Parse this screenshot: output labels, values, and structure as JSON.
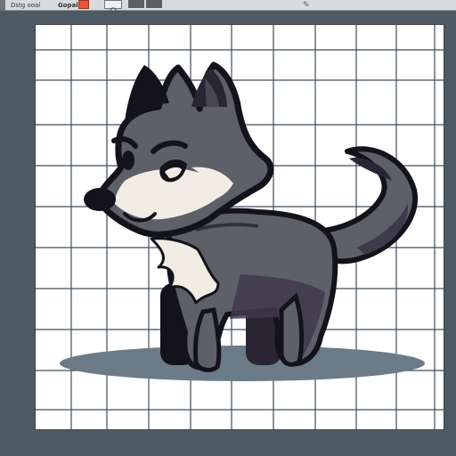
{
  "toolbar": {
    "label_left": "Dstg ooal",
    "label_mode": "Gopal",
    "dropdown_arrow": "▾",
    "icons": [
      "left-scroll-icon",
      "eye-icon",
      "copy-icon",
      "square-icon",
      "color-swatch-icon",
      "circle-icon",
      "arrow-icon",
      "layers-icon",
      "pen-icon"
    ],
    "swatch_color": "#e8553a"
  },
  "colors": {
    "background": "#4e5a63",
    "canvas": "#ffffff",
    "grid": "#1e2e3a",
    "fur_main": "#5e6068",
    "fur_dark": "#3f3a4a",
    "outline": "#14121a",
    "fur_light": "#f2ede4",
    "shadow": "#6b7c88"
  },
  "canvas": {
    "subject": "wolf-illustration"
  }
}
